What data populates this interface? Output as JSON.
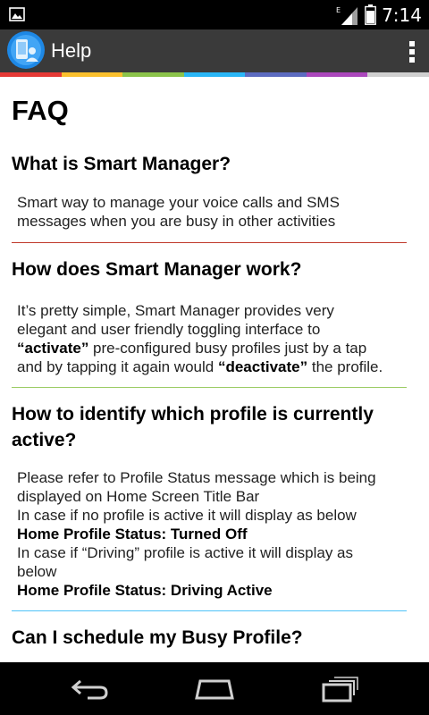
{
  "status_bar": {
    "time": "7:14",
    "network_label": "E",
    "icons": [
      "image-notification-icon",
      "signal-icon",
      "battery-icon"
    ]
  },
  "action_bar": {
    "title": "Help",
    "icons": [
      "smart-manager-app-icon",
      "overflow-menu-icon"
    ]
  },
  "stripe_colors": [
    "#e53935",
    "#fbc02d",
    "#8bc34a",
    "#29b6f6",
    "#5c6bc0",
    "#ab47bc",
    "#cfcfcf"
  ],
  "content": {
    "heading": "FAQ",
    "faqs": [
      {
        "question": "What is Smart Manager?",
        "answer_lines": [
          "Smart way to manage your voice calls and SMS",
          "messages when you are busy in other activities"
        ],
        "divider_color": "#c0392b"
      },
      {
        "question": "How does Smart Manager work?",
        "answer": {
          "line1": "It’s pretty simple, Smart Manager provides very",
          "line2": "elegant and user friendly toggling interface to",
          "activate_word": "“activate”",
          "line3_rest": " pre-configured busy profiles just by a tap",
          "line4_start": "and by tapping it again would ",
          "deactivate_word": "“deactivate”",
          "line4_end": " the profile."
        },
        "divider_color": "#9ccc65"
      },
      {
        "question_lines": [
          "How to identify which profile is currently",
          "active?"
        ],
        "answer": {
          "line1": "Please refer to Profile Status message which is being",
          "line2": "displayed on Home Screen Title Bar",
          "line3": "In case if no profile is active it will display as below",
          "line4_bold": "Home Profile Status: Turned Off",
          "line5": "In case if “Driving” profile is active it will display as",
          "line6": "below",
          "line7_bold": "Home Profile Status: Driving Active"
        },
        "divider_color": "#4fc3f7"
      },
      {
        "question": "Can I schedule my Busy Profile?"
      }
    ]
  },
  "nav_bar": {
    "buttons": [
      "back-icon",
      "home-icon",
      "recent-apps-icon"
    ]
  }
}
